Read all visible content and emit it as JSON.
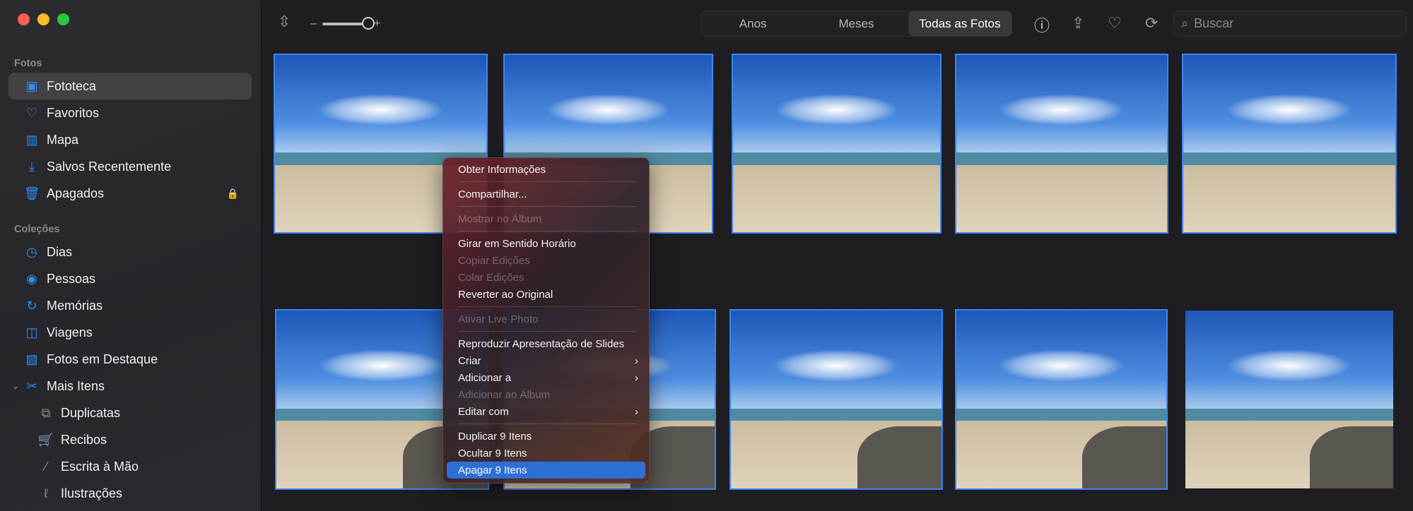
{
  "sidebar": {
    "section_fotos": "Fotos",
    "section_colecoes": "Coleções",
    "fotos_items": [
      {
        "label": "Fototeca",
        "icon": "photo-library-icon"
      },
      {
        "label": "Favoritos",
        "icon": "heart-icon"
      },
      {
        "label": "Mapa",
        "icon": "map-icon"
      },
      {
        "label": "Salvos Recentemente",
        "icon": "download-icon"
      },
      {
        "label": "Apagados",
        "icon": "trash-icon"
      }
    ],
    "colecoes_items": [
      {
        "label": "Dias"
      },
      {
        "label": "Pessoas"
      },
      {
        "label": "Memórias"
      },
      {
        "label": "Viagens"
      },
      {
        "label": "Fotos em Destaque"
      },
      {
        "label": "Mais Itens"
      }
    ],
    "sub_items": [
      {
        "label": "Duplicatas"
      },
      {
        "label": "Recibos"
      },
      {
        "label": "Escrita à Mão"
      },
      {
        "label": "Ilustrações"
      }
    ]
  },
  "toolbar": {
    "zoom_minus": "–",
    "zoom_plus": "+",
    "zoom_level": 0.85,
    "tabs": [
      "Anos",
      "Meses",
      "Todas as Fotos"
    ],
    "active_tab": "Todas as Fotos",
    "search_placeholder": "Buscar"
  },
  "context_menu": {
    "items": [
      "Obter Informações",
      "Compartilhar...",
      "Mostrar no Álbum",
      "Girar em Sentido Horário",
      "Copiar Edições",
      "Colar Edições",
      "Reverter ao Original",
      "Ativar Live Photo",
      "Reproduzir Apresentação de Slides",
      "Criar",
      "Adicionar a",
      "Adicionar ao Álbum",
      "Editar com",
      "Duplicar 9 Itens",
      "Ocultar 9 Itens",
      "Apagar 9 Itens"
    ]
  },
  "colors": {
    "accent": "#3a86f2",
    "highlight": "#2d6fd6"
  }
}
